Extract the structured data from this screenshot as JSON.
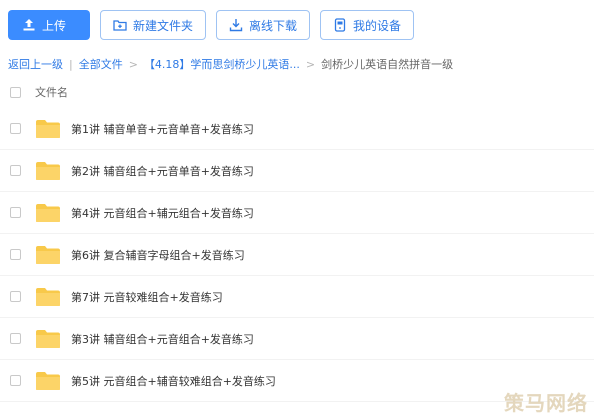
{
  "toolbar": {
    "upload_label": "上传",
    "new_folder_label": "新建文件夹",
    "offline_download_label": "离线下载",
    "my_devices_label": "我的设备"
  },
  "breadcrumb": {
    "back": "返回上一级",
    "all_files": "全部文件",
    "parent": "【4.18】学而思剑桥少儿英语...",
    "current": "剑桥少儿英语自然拼音一级"
  },
  "list": {
    "column_name": "文件名",
    "items": [
      "第1讲 辅音单音+元音单音+发音练习",
      "第2讲 辅音组合+元音单音+发音练习",
      "第4讲 元音组合+辅元组合+发音练习",
      "第6讲 复合辅音字母组合+发音练习",
      "第7讲 元音较难组合+发音练习",
      "第3讲 辅音组合+元音组合+发音练习",
      "第5讲 元音组合+辅音较难组合+发音练习"
    ]
  },
  "watermark": "策马网络",
  "colors": {
    "primary": "#3b8cff",
    "link": "#2f7ae5",
    "folder": "#f8c94a"
  }
}
